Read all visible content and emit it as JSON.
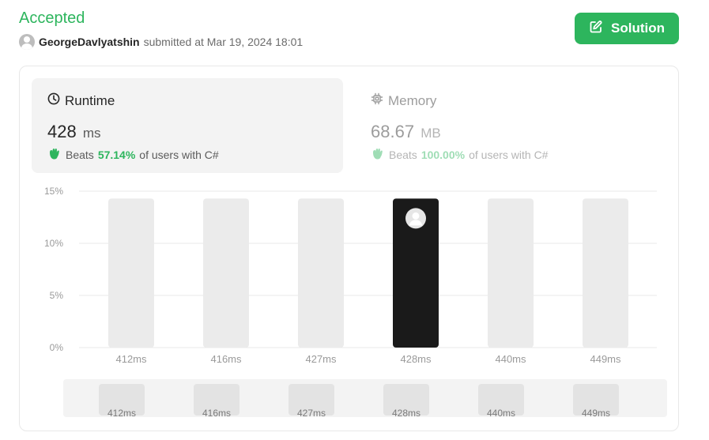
{
  "submission": {
    "status": "Accepted",
    "author": "GeorgeDavlyatshin",
    "submitted_text": "submitted at Mar 19, 2024 18:01"
  },
  "solution_button": {
    "label": "Solution"
  },
  "runtime": {
    "label": "Runtime",
    "value": "428",
    "unit": "ms",
    "beats_prefix": "Beats",
    "beats_pct": "57.14%",
    "beats_suffix": "of users with C#"
  },
  "memory": {
    "label": "Memory",
    "value": "68.67",
    "unit": "MB",
    "beats_prefix": "Beats",
    "beats_pct": "100.00%",
    "beats_suffix": "of users with C#"
  },
  "colors": {
    "accent": "#2db55d",
    "bar": "#ebebeb",
    "bar_selected": "#1a1a1a"
  },
  "icons": {
    "runtime": "clock-icon",
    "memory": "chip-icon",
    "beats": "hand-icon",
    "solution": "edit-icon"
  },
  "chart_data": {
    "type": "bar",
    "categories": [
      "412ms",
      "416ms",
      "427ms",
      "428ms",
      "440ms",
      "449ms"
    ],
    "values": [
      14.29,
      14.29,
      14.29,
      14.29,
      14.29,
      14.29
    ],
    "selected_index": 3,
    "yticks": [
      "0%",
      "5%",
      "10%",
      "15%"
    ],
    "ylim": [
      0,
      15
    ],
    "grid": true
  }
}
